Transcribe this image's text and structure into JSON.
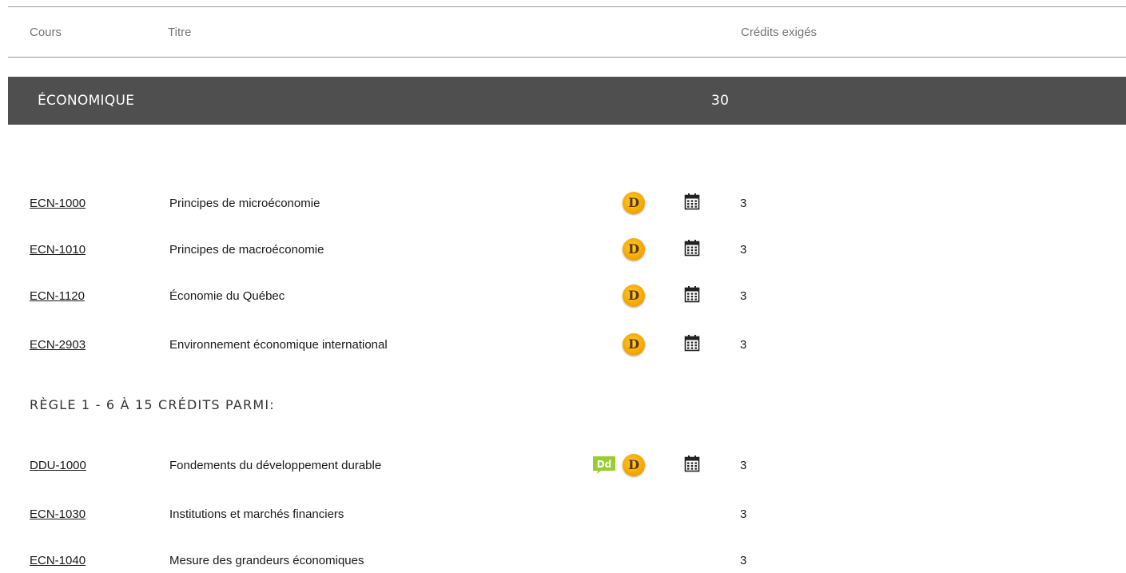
{
  "header": {
    "col_course": "Cours",
    "col_title": "Titre",
    "col_credits": "Crédits exigés"
  },
  "section": {
    "name": "ÉCONOMIQUE",
    "credits": "30"
  },
  "courses_required": [
    {
      "code": "ECN-1000",
      "title": "Principes de microéconomie",
      "credits": "3",
      "badge_d": true,
      "badge_dd": false,
      "calendar": true
    },
    {
      "code": "ECN-1010",
      "title": "Principes de macroéconomie",
      "credits": "3",
      "badge_d": true,
      "badge_dd": false,
      "calendar": true
    },
    {
      "code": "ECN-1120",
      "title": "Économie du Québec",
      "credits": "3",
      "badge_d": true,
      "badge_dd": false,
      "calendar": true
    },
    {
      "code": "ECN-2903",
      "title": "Environnement économique international",
      "credits": "3",
      "badge_d": true,
      "badge_dd": false,
      "calendar": true
    }
  ],
  "rule": {
    "label": "RÈGLE 1 - 6 À 15 CRÉDITS PARMI:"
  },
  "courses_rule": [
    {
      "code": "DDU-1000",
      "title": "Fondements du développement durable",
      "credits": "3",
      "badge_d": true,
      "badge_dd": true,
      "calendar": true
    },
    {
      "code": "ECN-1030",
      "title": "Institutions et marchés financiers",
      "credits": "3",
      "badge_d": false,
      "badge_dd": false,
      "calendar": false
    },
    {
      "code": "ECN-1040",
      "title": "Mesure des grandeurs économiques",
      "credits": "3",
      "badge_d": false,
      "badge_dd": false,
      "calendar": false
    }
  ],
  "icons": {
    "badge_d_letter": "D",
    "badge_dd_letters": "Dd",
    "badge_d_color": "#f4a800",
    "badge_dd_color": "#9acd32",
    "section_bar_color": "#4f4f4f"
  }
}
